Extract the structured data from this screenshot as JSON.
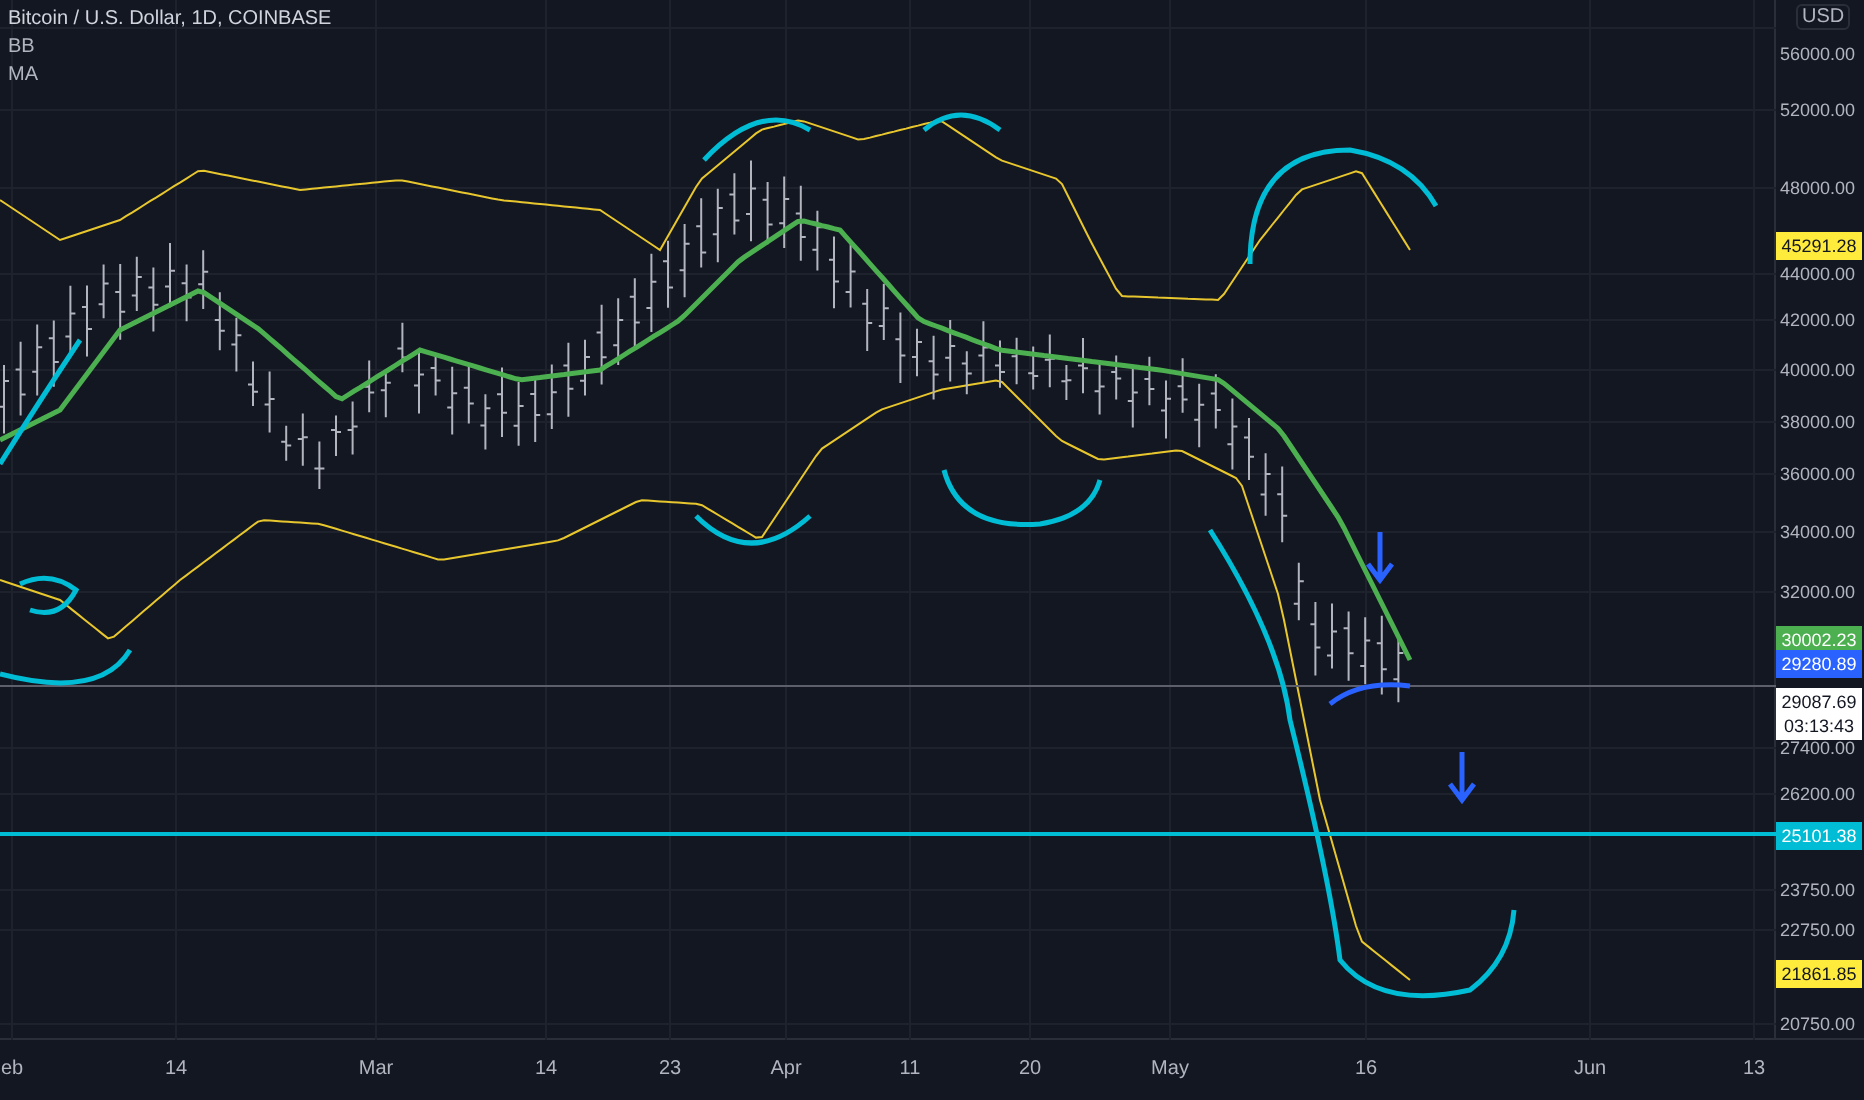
{
  "legend": {
    "title": "Bitcoin / U.S. Dollar, 1D, COINBASE",
    "indicators": [
      "BB",
      "MA"
    ]
  },
  "price_axis": {
    "currency": "USD",
    "ticks": [
      "56000.00",
      "52000.00",
      "48000.00",
      "44000.00",
      "42000.00",
      "40000.00",
      "38000.00",
      "36000.00",
      "34000.00",
      "32000.00",
      "27400.00",
      "26200.00",
      "23750.00",
      "22750.00",
      "20750.00"
    ]
  },
  "price_tags": [
    {
      "label": "45291.28",
      "color": "#ffeb3b"
    },
    {
      "label": "30002.23",
      "color": "#4caf50"
    },
    {
      "label": "29280.89",
      "color": "#2962ff"
    },
    {
      "label": "29087.69",
      "sub": "03:13:43",
      "color": "#ffffff"
    },
    {
      "label": "25101.38",
      "color": "#00bcd4"
    },
    {
      "label": "21861.85",
      "color": "#ffeb3b"
    }
  ],
  "time_axis": [
    "eb",
    "14",
    "Mar",
    "14",
    "23",
    "Apr",
    "11",
    "20",
    "May",
    "16",
    "Jun",
    "13"
  ]
}
